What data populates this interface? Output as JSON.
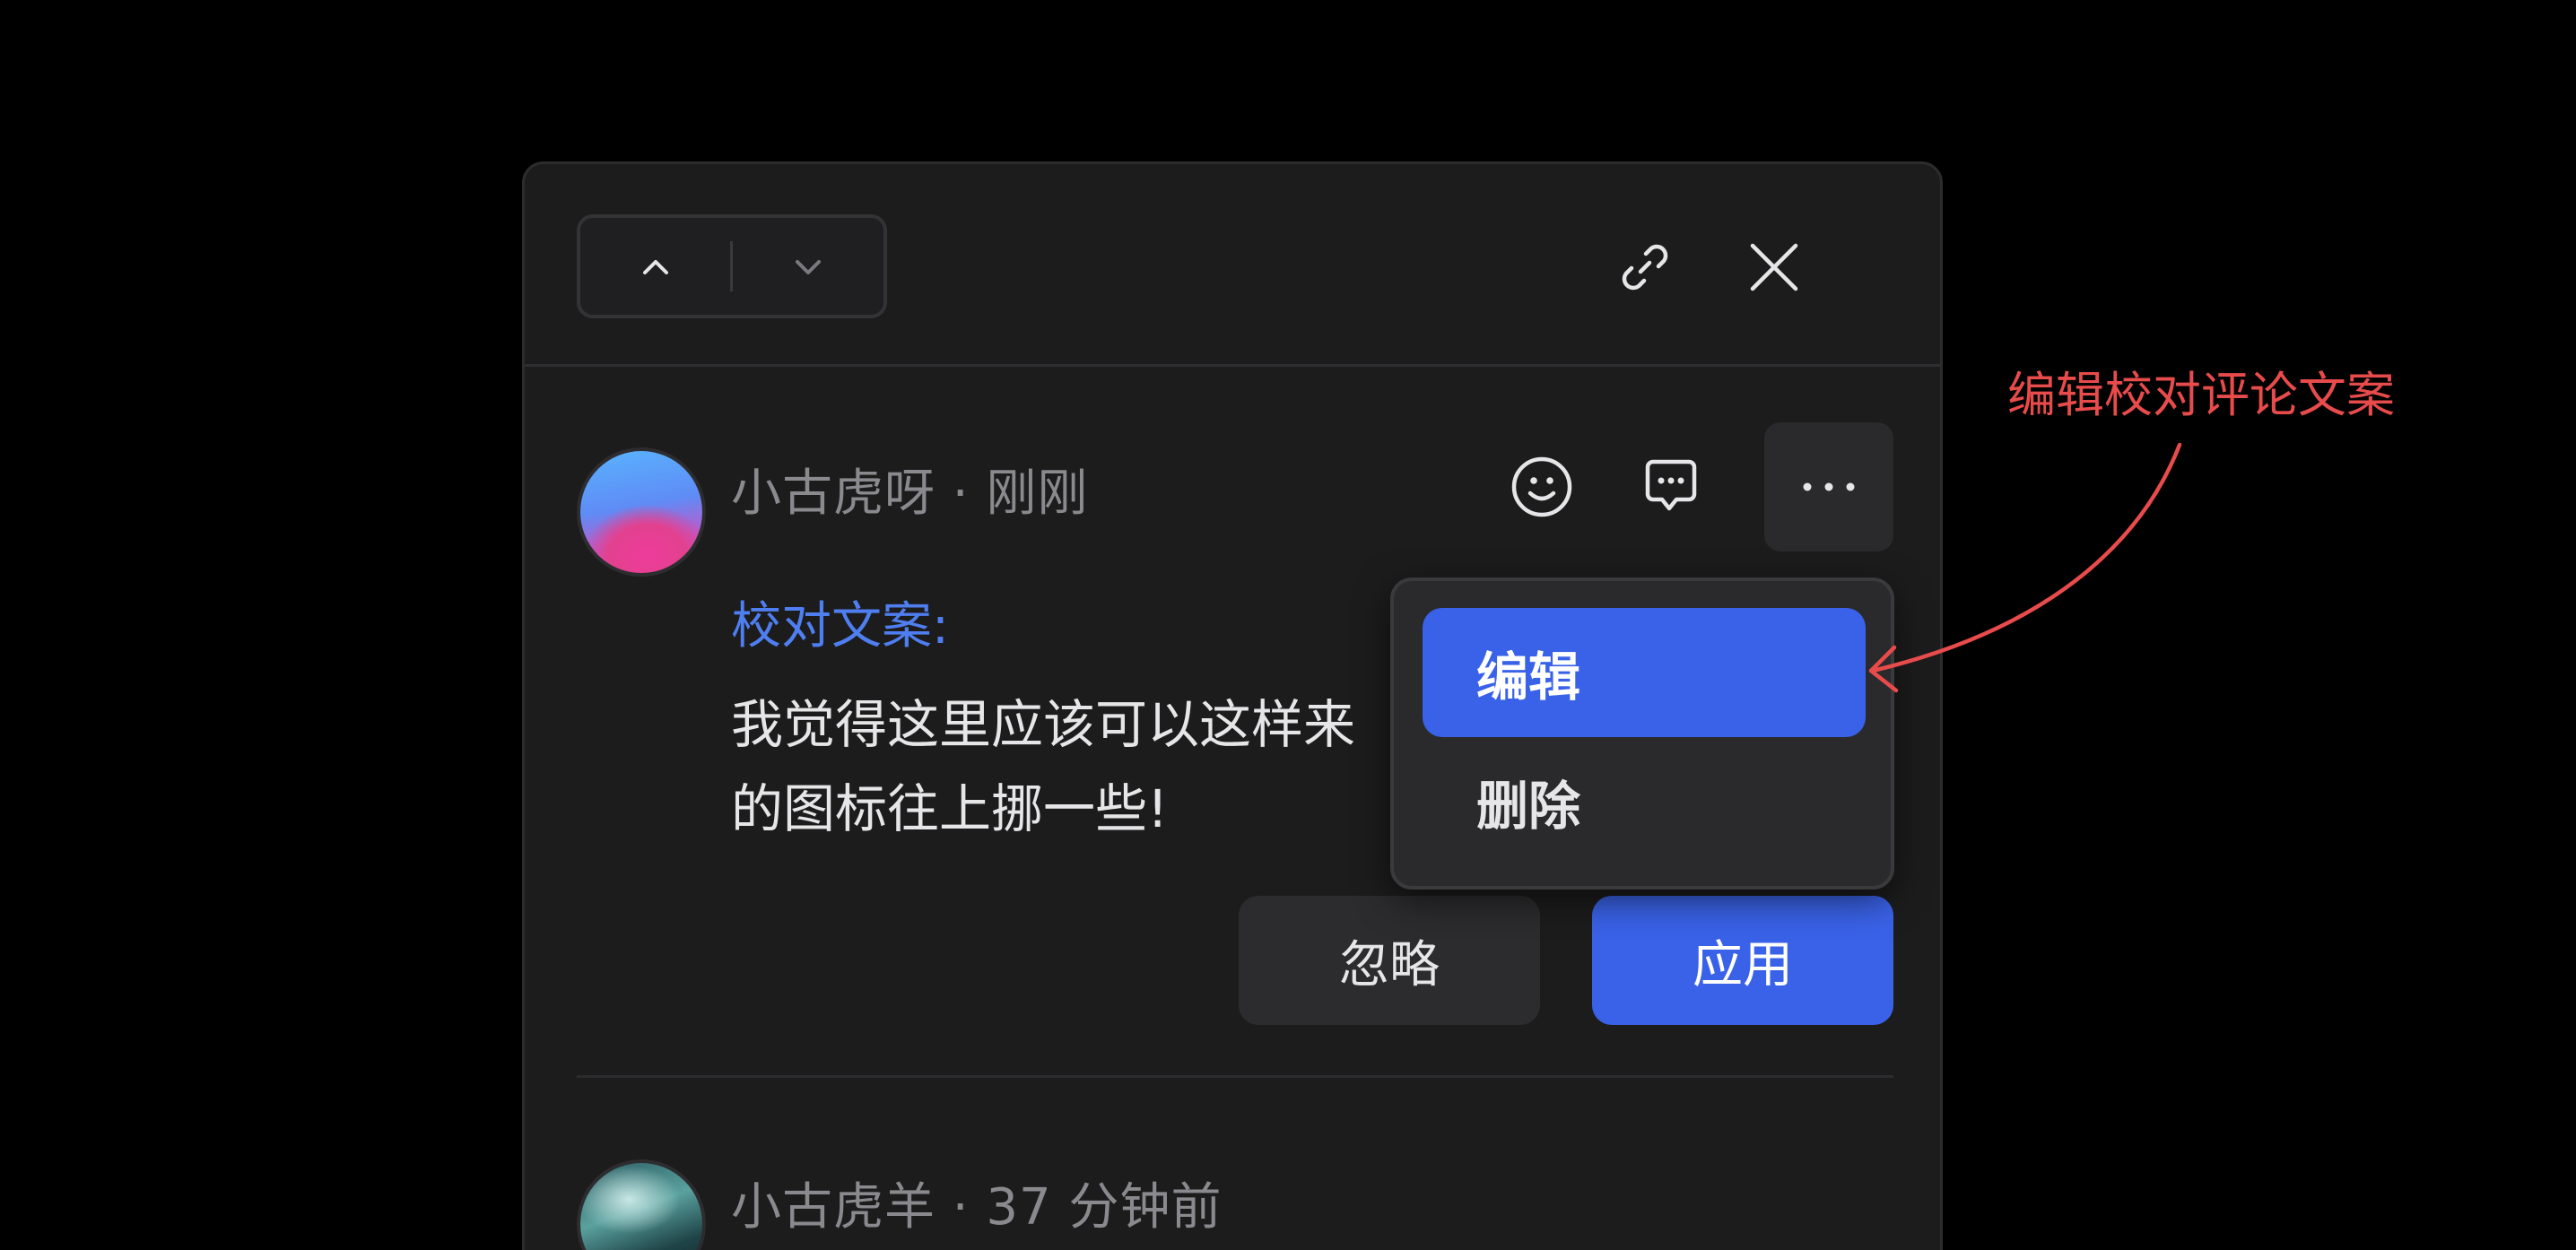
{
  "panel": {
    "header": {
      "nav_up_icon": "chevron-up-icon",
      "nav_down_icon": "chevron-down-icon",
      "link_icon": "link-icon",
      "close_icon": "close-icon"
    },
    "comments": [
      {
        "author_line": "小古虎呀 · 刚刚",
        "label": "校对文案:",
        "body_line1": "我觉得这里应该可以这样来",
        "body_line2": "的图标往上挪一些!",
        "ignore_label": "忽略",
        "apply_label": "应用"
      },
      {
        "author_line": "小古虎羊 · 37 分钟前"
      }
    ],
    "actions": {
      "emoji_icon": "emoji-icon",
      "reply_icon": "comment-icon",
      "more_icon": "more-icon"
    }
  },
  "menu": {
    "items": [
      {
        "label": "编辑"
      },
      {
        "label": "删除"
      }
    ]
  },
  "annotation": {
    "text": "编辑校对评论文案"
  },
  "colors": {
    "background": "#000000",
    "panel": "#1c1c1d",
    "accent": "#3a62e8",
    "label_blue": "#4f7ef0",
    "annotation_red": "#e84b4b"
  }
}
